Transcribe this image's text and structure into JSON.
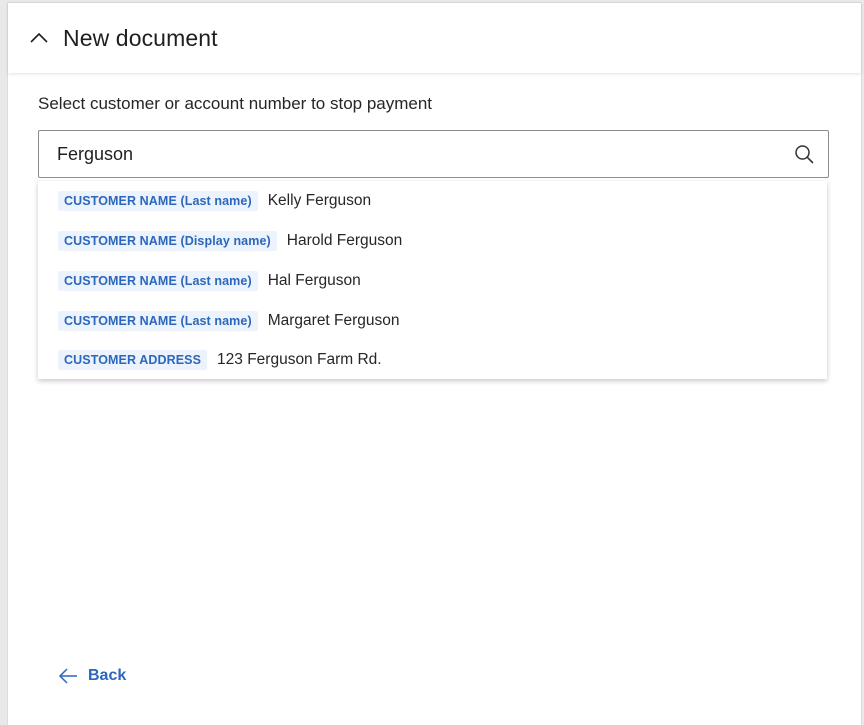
{
  "header": {
    "title": "New document",
    "collapse_icon": "chevron-up-icon"
  },
  "form": {
    "label": "Select customer or account number to stop payment",
    "search_value": "Ferguson",
    "search_icon": "search-icon"
  },
  "results": [
    {
      "tag": "CUSTOMER NAME (Last name)",
      "value": "Kelly Ferguson"
    },
    {
      "tag": "CUSTOMER NAME (Display name)",
      "value": "Harold Ferguson"
    },
    {
      "tag": "CUSTOMER NAME (Last name)",
      "value": "Hal Ferguson"
    },
    {
      "tag": "CUSTOMER NAME (Last name)",
      "value": "Margaret Ferguson"
    },
    {
      "tag": "CUSTOMER ADDRESS",
      "value": "123 Ferguson Farm Rd."
    }
  ],
  "footer": {
    "back_label": "Back",
    "back_icon": "arrow-left-icon"
  },
  "colors": {
    "accent": "#2b67bd",
    "tag_background": "#ecf3fc",
    "text": "#1f1f1f",
    "border": "#8c8c8c"
  }
}
